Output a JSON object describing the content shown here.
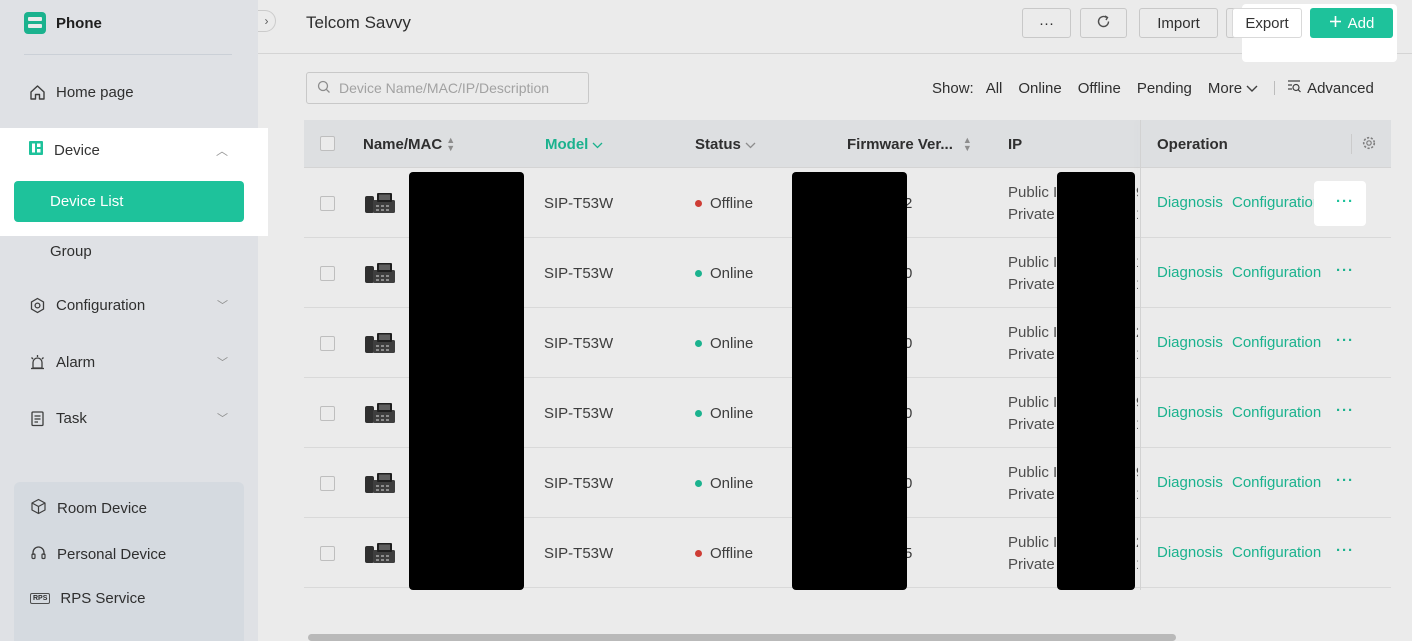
{
  "sidebar": {
    "brand": "Phone",
    "nav": {
      "home": "Home page",
      "device": "Device",
      "device_list": "Device List",
      "group": "Group",
      "configuration": "Configuration",
      "alarm": "Alarm",
      "task": "Task"
    },
    "services": {
      "room": "Room Device",
      "personal": "Personal Device",
      "rps": "RPS Service",
      "rps_icon_text": "RPS"
    }
  },
  "header": {
    "title": "Telcom Savvy",
    "more_label": "···",
    "import_label": "Import",
    "export_label": "Export",
    "add_label": "Add"
  },
  "toolbar": {
    "search_placeholder": "Device Name/MAC/IP/Description",
    "show_label": "Show:",
    "filters": [
      "All",
      "Online",
      "Offline",
      "Pending",
      "More"
    ],
    "advanced_label": "Advanced"
  },
  "table": {
    "columns": {
      "name": "Name/MAC",
      "model": "Model",
      "status": "Status",
      "firmware": "Firmware Ver...",
      "ip": "IP",
      "operation": "Operation"
    },
    "rows": [
      {
        "model": "SIP-T53W",
        "status": "Offline",
        "status_color": "#e0433a",
        "fw_tail": "2",
        "ip_public": "Public I",
        "ip_private": "Private",
        "ip_tail1": "9",
        "ip_tail2": "1"
      },
      {
        "model": "SIP-T53W",
        "status": "Online",
        "status_color": "#1ec29b",
        "fw_tail": "0",
        "ip_public": "Public I",
        "ip_private": "Private",
        "ip_tail1": "1",
        "ip_tail2": "1"
      },
      {
        "model": "SIP-T53W",
        "status": "Online",
        "status_color": "#1ec29b",
        "fw_tail": "0",
        "ip_public": "Public I",
        "ip_private": "Private",
        "ip_tail1": "2",
        "ip_tail2": "1"
      },
      {
        "model": "SIP-T53W",
        "status": "Online",
        "status_color": "#1ec29b",
        "fw_tail": "0",
        "ip_public": "Public I",
        "ip_private": "Private",
        "ip_tail1": "9",
        "ip_tail2": "1"
      },
      {
        "model": "SIP-T53W",
        "status": "Online",
        "status_color": "#1ec29b",
        "fw_tail": "0",
        "ip_public": "Public I",
        "ip_private": "Private",
        "ip_tail1": "9",
        "ip_tail2": "1"
      },
      {
        "model": "SIP-T53W",
        "status": "Offline",
        "status_color": "#e0433a",
        "fw_tail": "5",
        "ip_public": "Public I",
        "ip_private": "Private",
        "ip_tail1": "2",
        "ip_tail2": "1"
      }
    ],
    "op_diagnosis": "Diagnosis",
    "op_configuration": "Configuration",
    "op_more": "···"
  },
  "colors": {
    "accent": "#1ec29b",
    "offline": "#e0433a"
  }
}
